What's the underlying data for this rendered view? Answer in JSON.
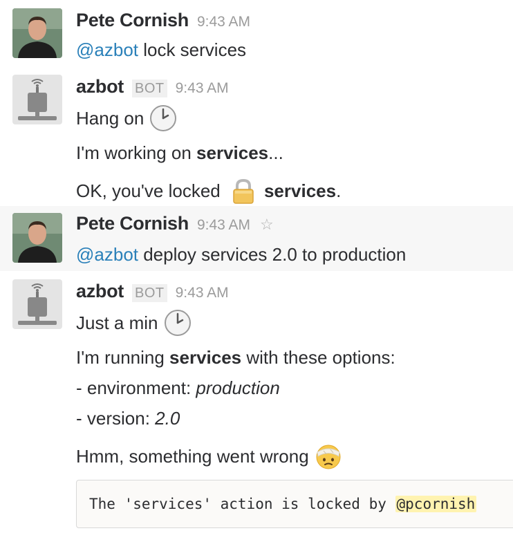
{
  "messages": [
    {
      "author": "Pete Cornish",
      "time": "9:43 AM",
      "text": {
        "mention": "@azbot",
        "rest": " lock services"
      }
    },
    {
      "author": "azbot",
      "badge": "BOT",
      "time": "9:43 AM",
      "lines": [
        {
          "text": "Hang on",
          "emoji": "clock-icon"
        },
        {
          "pre": "I'm working on ",
          "bold": "services",
          "post": "..."
        },
        {
          "pre": "OK, you've locked ",
          "emoji": "lock-icon",
          "bold": "services",
          "post": "."
        }
      ]
    },
    {
      "author": "Pete Cornish",
      "time": "9:43 AM",
      "star_icon": "star-icon",
      "text": {
        "mention": "@azbot",
        "rest": " deploy services 2.0 to production"
      }
    },
    {
      "author": "azbot",
      "badge": "BOT",
      "time": "9:43 AM",
      "lines": [
        {
          "text": "Just a min",
          "emoji": "clock-icon"
        },
        {
          "pre": "I'm running ",
          "bold": "services",
          "post": " with these options:"
        },
        {
          "pre": "- environment: ",
          "italic": "production"
        },
        {
          "pre": "- version: ",
          "italic": "2.0"
        },
        {
          "text": "Hmm, something went wrong",
          "emoji": "face-with-head-bandage-icon"
        }
      ],
      "code": {
        "pre": "The 'services' action is locked by ",
        "mention": "@pcornish"
      }
    }
  ],
  "colors": {
    "mention": "#2a80b9",
    "hover_row": "#f7f7f7",
    "code_mention_bg": "#fff3b0",
    "timestamp": "#9b9b9b"
  }
}
